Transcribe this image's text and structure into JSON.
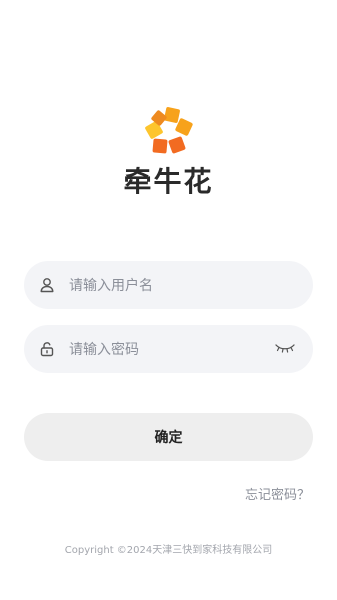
{
  "brand": {
    "name": "牵牛花",
    "logo_icon": "pinwheel-flower-logo-icon",
    "colors": [
      "#f7a21b",
      "#f26b21",
      "#fdc52d",
      "#ee8a1f"
    ]
  },
  "form": {
    "username": {
      "placeholder": "请输入用户名",
      "icon": "user-icon"
    },
    "password": {
      "placeholder": "请输入密码",
      "icon": "unlock-icon",
      "toggle_icon": "eye-closed-icon"
    },
    "submit_label": "确定",
    "forgot_label": "忘记密码？"
  },
  "footer": {
    "copyright": "Copyright ©2024天津三快到家科技有限公司"
  }
}
